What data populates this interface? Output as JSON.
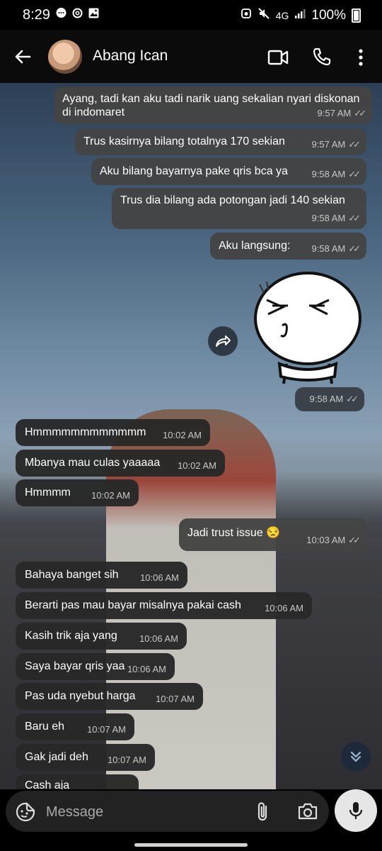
{
  "status_bar": {
    "time": "8:29",
    "network": "4G",
    "battery_percent": "100%",
    "left_icons": [
      "chat-bubble-icon",
      "threads-icon",
      "image-icon"
    ],
    "right_icons": [
      "alarm-icon",
      "mute-icon",
      "signal-icon",
      "battery-icon"
    ]
  },
  "header": {
    "contact_name": "Abang Ican",
    "icons": [
      "back-arrow-icon",
      "video-call-icon",
      "phone-call-icon",
      "more-vert-icon"
    ]
  },
  "messages": [
    {
      "dir": "out",
      "text": "Ayang, tadi kan aku tadi narik uang sekalian nyari diskonan di indomaret",
      "time": "9:57 AM",
      "read": true
    },
    {
      "dir": "out",
      "text": "Trus kasirnya bilang totalnya 170 sekian",
      "time": "9:57 AM",
      "read": true
    },
    {
      "dir": "out",
      "text": "Aku bilang bayarnya pake qris bca ya",
      "time": "9:58 AM",
      "read": true
    },
    {
      "dir": "out",
      "text": "Trus dia bilang ada potongan jadi 140 sekian",
      "time": "9:58 AM",
      "read": true
    },
    {
      "dir": "out",
      "text": "Aku langsung:",
      "time": "9:58 AM",
      "read": true
    },
    {
      "dir": "out",
      "text": "",
      "sticker": true,
      "time": "9:58 AM",
      "read": true
    },
    {
      "dir": "in",
      "text": "Hmmmmmmmmmmmm",
      "time": "10:02 AM"
    },
    {
      "dir": "in",
      "text": "Mbanya mau culas yaaaaa",
      "time": "10:02 AM"
    },
    {
      "dir": "in",
      "text": "Hmmmm",
      "time": "10:02 AM"
    },
    {
      "dir": "out",
      "text": "Jadi trust issue 😒",
      "time": "10:03 AM",
      "read": true
    },
    {
      "dir": "in",
      "text": "Bahaya banget sih",
      "time": "10:06 AM"
    },
    {
      "dir": "in",
      "text": "Berarti pas mau bayar misalnya pakai cash",
      "time": "10:06 AM"
    },
    {
      "dir": "in",
      "text": "Kasih trik aja yang",
      "time": "10:06 AM"
    },
    {
      "dir": "in",
      "text": "Saya bayar qris yaa",
      "time": "10:06 AM"
    },
    {
      "dir": "in",
      "text": "Pas uda nyebut harga",
      "time": "10:07 AM"
    },
    {
      "dir": "in",
      "text": "Baru eh",
      "time": "10:07 AM"
    },
    {
      "dir": "in",
      "text": "Gak jadi deh",
      "time": "10:07 AM"
    },
    {
      "dir": "in",
      "text": "Cash aja",
      "time": ""
    }
  ],
  "composer": {
    "placeholder": "Message",
    "icons": [
      "sticker-icon",
      "attach-icon",
      "camera-icon",
      "mic-icon"
    ]
  },
  "colors": {
    "outgoing_bubble": "#444444",
    "incoming_bubble": "#282828",
    "header_bg": "#0b0b0b",
    "mic_button": "#e6e6e6"
  }
}
